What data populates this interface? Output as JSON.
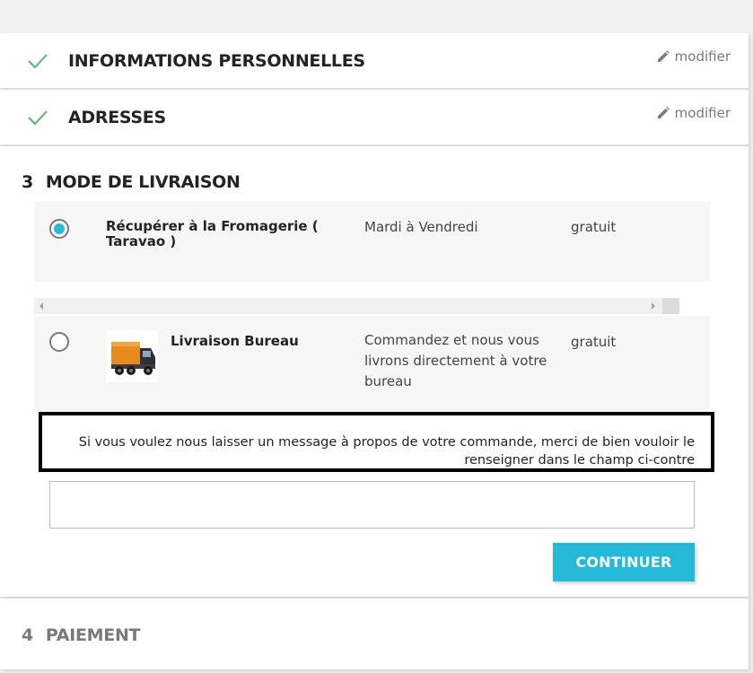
{
  "steps": {
    "personal": {
      "title": "INFORMATIONS PERSONNELLES",
      "edit_label": "modifier"
    },
    "addresses": {
      "title": "ADRESSES",
      "edit_label": "modifier"
    },
    "delivery": {
      "number": "3",
      "title": "MODE DE LIVRAISON",
      "carriers": [
        {
          "name": "Récupérer à la Fromagerie ( Taravao )",
          "delay": "Mardi à Vendredi",
          "price": "gratuit",
          "selected": true
        },
        {
          "name": "Livraison Bureau",
          "delay": "Commandez et nous vous livrons directement à votre bureau",
          "price": "gratuit",
          "selected": false,
          "logo": "delivery-truck-icon"
        }
      ],
      "message_prompt": "Si vous voulez nous laisser un message à propos de votre commande, merci de bien vouloir le renseigner dans le champ ci-contre",
      "message_value": "",
      "continue_label": "CONTINUER"
    },
    "payment": {
      "number": "4",
      "title": "PAIEMENT"
    }
  },
  "colors": {
    "accent": "#24b9d7",
    "check": "#4cbb6c"
  }
}
